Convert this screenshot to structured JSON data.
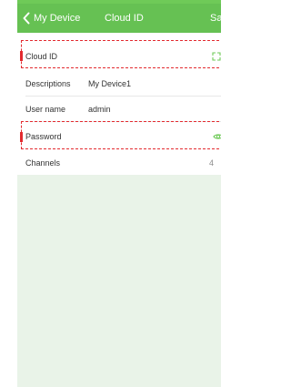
{
  "header": {
    "back_label": "My Device",
    "title": "Cloud ID",
    "save_label": "Sav"
  },
  "form": {
    "cloud_id": {
      "label": "Cloud ID",
      "value": "",
      "icon": "scan-icon"
    },
    "descriptions": {
      "label": "Descriptions",
      "value": "My Device1"
    },
    "user_name": {
      "label": "User name",
      "value": "admin"
    },
    "password": {
      "label": "Password",
      "value": "",
      "icon": "eye-icon"
    },
    "channels": {
      "label": "Channels",
      "value": "4"
    }
  },
  "colors": {
    "header_green": "#66c153",
    "accent_green": "#6fca58",
    "highlight_red": "#e32a2f",
    "content_background": "#e9f3e8",
    "row_background": "#ffffff",
    "text_dark": "#333333",
    "text_muted": "#8d8d8d"
  }
}
